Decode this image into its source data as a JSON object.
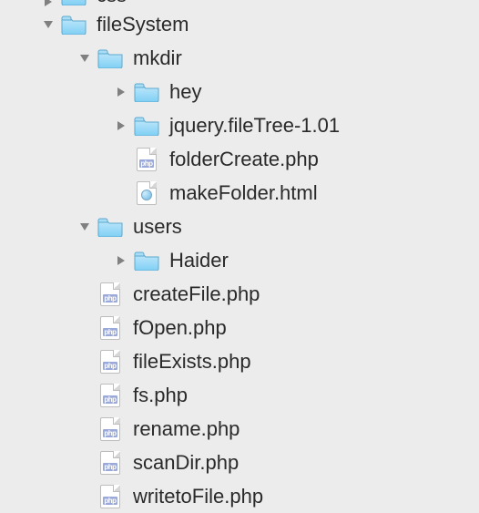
{
  "tree": {
    "css": {
      "label": "css",
      "depth": 1,
      "type": "folder",
      "state": "collapsed",
      "partial": "top"
    },
    "fileSystem": {
      "label": "fileSystem",
      "depth": 1,
      "type": "folder",
      "state": "expanded"
    },
    "mkdir": {
      "label": "mkdir",
      "depth": 2,
      "type": "folder",
      "state": "expanded"
    },
    "hey": {
      "label": "hey",
      "depth": 3,
      "type": "folder",
      "state": "collapsed"
    },
    "jft": {
      "label": "jquery.fileTree-1.01",
      "depth": 3,
      "type": "folder",
      "state": "collapsed"
    },
    "folderCreate": {
      "label": "folderCreate.php",
      "depth": 3,
      "type": "php"
    },
    "makeFolder": {
      "label": "makeFolder.html",
      "depth": 3,
      "type": "html"
    },
    "users": {
      "label": "users",
      "depth": 2,
      "type": "folder",
      "state": "expanded"
    },
    "Haider": {
      "label": "Haider",
      "depth": 3,
      "type": "folder",
      "state": "collapsed"
    },
    "createFile": {
      "label": "createFile.php",
      "depth": 2,
      "type": "php"
    },
    "fOpen": {
      "label": "fOpen.php",
      "depth": 2,
      "type": "php"
    },
    "fileExists": {
      "label": "fileExists.php",
      "depth": 2,
      "type": "php"
    },
    "fs": {
      "label": "fs.php",
      "depth": 2,
      "type": "php"
    },
    "rename": {
      "label": "rename.php",
      "depth": 2,
      "type": "php"
    },
    "scanDir": {
      "label": "scanDir.php",
      "depth": 2,
      "type": "php"
    },
    "writetoFile": {
      "label": "writetoFile.php",
      "depth": 2,
      "type": "php"
    }
  }
}
